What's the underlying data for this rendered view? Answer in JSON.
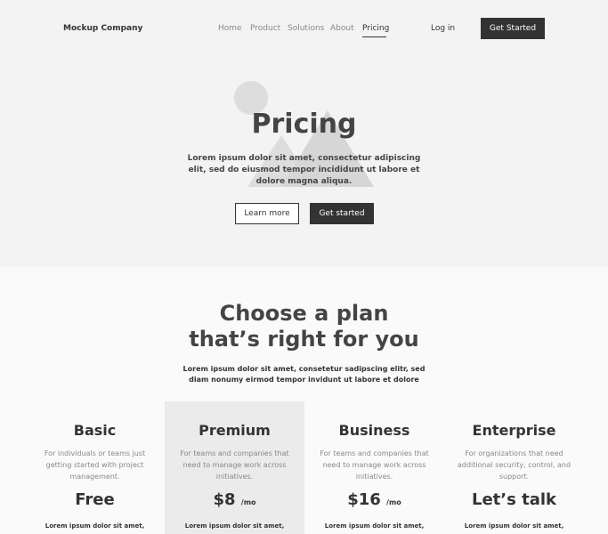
{
  "nav": {
    "logo": "Mockup Company",
    "links": [
      "Home",
      "Product",
      "Solutions",
      "About",
      "Pricing"
    ],
    "active": "Pricing",
    "login": "Log in",
    "cta": "Get Started"
  },
  "hero": {
    "title": "Pricing",
    "description": "Lorem ipsum dolor sit amet, consectetur adipiscing elit, sed do eiusmod tempor incididunt ut labore et dolore magna aliqua.",
    "btn_learn_more": "Learn more",
    "btn_get_started": "Get started"
  },
  "plans_section": {
    "heading_line1": "Choose a plan",
    "heading_line2": "that’s right for you",
    "subtitle": "Lorem ipsum dolor sit amet, consetetur sadipscing elitr, sed diam nonumy eirmod tempor invidunt ut labore et dolore"
  },
  "plans": [
    {
      "name": "Basic",
      "description": "For individuals or teams just getting started with project management.",
      "price": "Free",
      "per": "",
      "foot": "Lorem ipsum dolor sit amet,"
    },
    {
      "name": "Premium",
      "description": "For teams and companies that need to manage work across initiatives.",
      "price": "$8",
      "per": "/mo",
      "foot": "Lorem ipsum dolor sit amet,"
    },
    {
      "name": "Business",
      "description": "For teams and companies that need to manage work across initiatives.",
      "price": "$16",
      "per": "/mo",
      "foot": "Lorem ipsum dolor sit amet,"
    },
    {
      "name": "Enterprise",
      "description": "For organizations that need additional security, control, and support.",
      "price": "Let’s talk",
      "per": "",
      "foot": "Lorem ipsum dolor sit amet,"
    }
  ],
  "colors": {
    "primary": "#333333",
    "hero_bg": "#f3f3f3",
    "page_bg": "#fafafa",
    "highlight_bg": "#ebebeb",
    "muted_text": "#888888",
    "art_shape": "#dddddd"
  }
}
